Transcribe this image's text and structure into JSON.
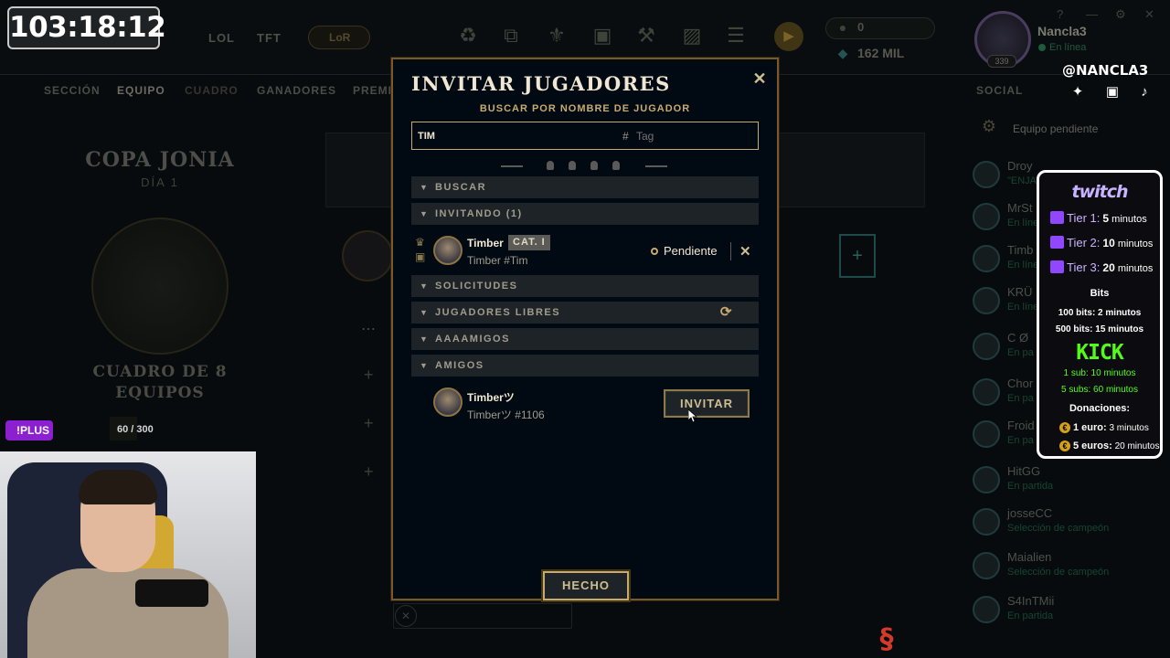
{
  "timer": "103:18:12",
  "topbar": {
    "nav_lol": "LOL",
    "nav_tft": "TFT",
    "nav_lor": "LoR",
    "rp": "0",
    "be": "162 MIL",
    "level": "339",
    "username": "Nancla3",
    "status": "En línea"
  },
  "overlay": {
    "handle": "@NANCLA3",
    "plus": "!PLUS",
    "counter": "60 / 300"
  },
  "subnav": [
    "SECCIÓN",
    "EQUIPO",
    "CUADRO",
    "GANADORES",
    "PREMI"
  ],
  "left_panel": {
    "title": "COPA JONIA",
    "day": "DÍA 1",
    "bracket": "CUADRO DE 8",
    "bracket2": "EQUIPOS"
  },
  "social": {
    "title": "SOCIAL",
    "pending": "Equipo pendiente",
    "friends": [
      {
        "name": "Droy",
        "status": "\"ENJA"
      },
      {
        "name": "MrSt",
        "status": "En líne"
      },
      {
        "name": "Timb",
        "status": "En líne"
      },
      {
        "name": "KRÜ",
        "status": "En líne"
      },
      {
        "name": "C Ø",
        "status": "En pa"
      },
      {
        "name": "Chor",
        "status": "En pa"
      },
      {
        "name": "Froid",
        "status": "En pa"
      },
      {
        "name": "HitGG",
        "status": "En partida"
      },
      {
        "name": "josseCC",
        "status": "Selección de campeón"
      },
      {
        "name": "Maialien",
        "status": "Selección de campeón"
      },
      {
        "name": "S4InTMii",
        "status": "En partida"
      }
    ]
  },
  "sub_panel": {
    "twitch": "twitch",
    "tiers": [
      {
        "label": "Tier 1:",
        "value": "5",
        "unit": "minutos"
      },
      {
        "label": "Tier 2:",
        "value": "10",
        "unit": "minutos"
      },
      {
        "label": "Tier 3:",
        "value": "20",
        "unit": "minutos"
      }
    ],
    "bits_title": "Bits",
    "bits1": "100 bits: 2 minutos",
    "bits2": "500 bits: 15 minutos",
    "kick": "KICK",
    "kick1": "1 sub: 10 minutos",
    "kick2": "5 subs: 60 minutos",
    "donations_title": "Donaciones:",
    "don1_a": "1 euro:",
    "don1_b": "3 minutos",
    "don2_a": "5 euros:",
    "don2_b": "20 minutos"
  },
  "modal": {
    "title": "INVITAR JUGADORES",
    "subtitle": "BUSCAR POR NOMBRE DE JUGADOR",
    "search_value": "TIM",
    "tag_placeholder": "Tag",
    "sections": {
      "buscar": "BUSCAR",
      "invitando": "INVITANDO (1)",
      "solicitudes": "SOLICITUDES",
      "libres": "JUGADORES LIBRES",
      "aaaamigos": "AAAAMIGOS",
      "amigos": "AMIGOS"
    },
    "invited": {
      "name": "Timber",
      "badge": "CAT. I",
      "tag": "Timber #Tim",
      "status": "Pendiente"
    },
    "friend": {
      "name": "Timberツ",
      "tag": "Timberツ #1106",
      "invite_label": "INVITAR"
    },
    "done_label": "HECHO"
  },
  "colors": {
    "gold": "#c8aa6e",
    "gold_light": "#f0e6d2",
    "modal_bg": "#010a13",
    "twitch": "#9146ff",
    "kick": "#53fc18"
  }
}
